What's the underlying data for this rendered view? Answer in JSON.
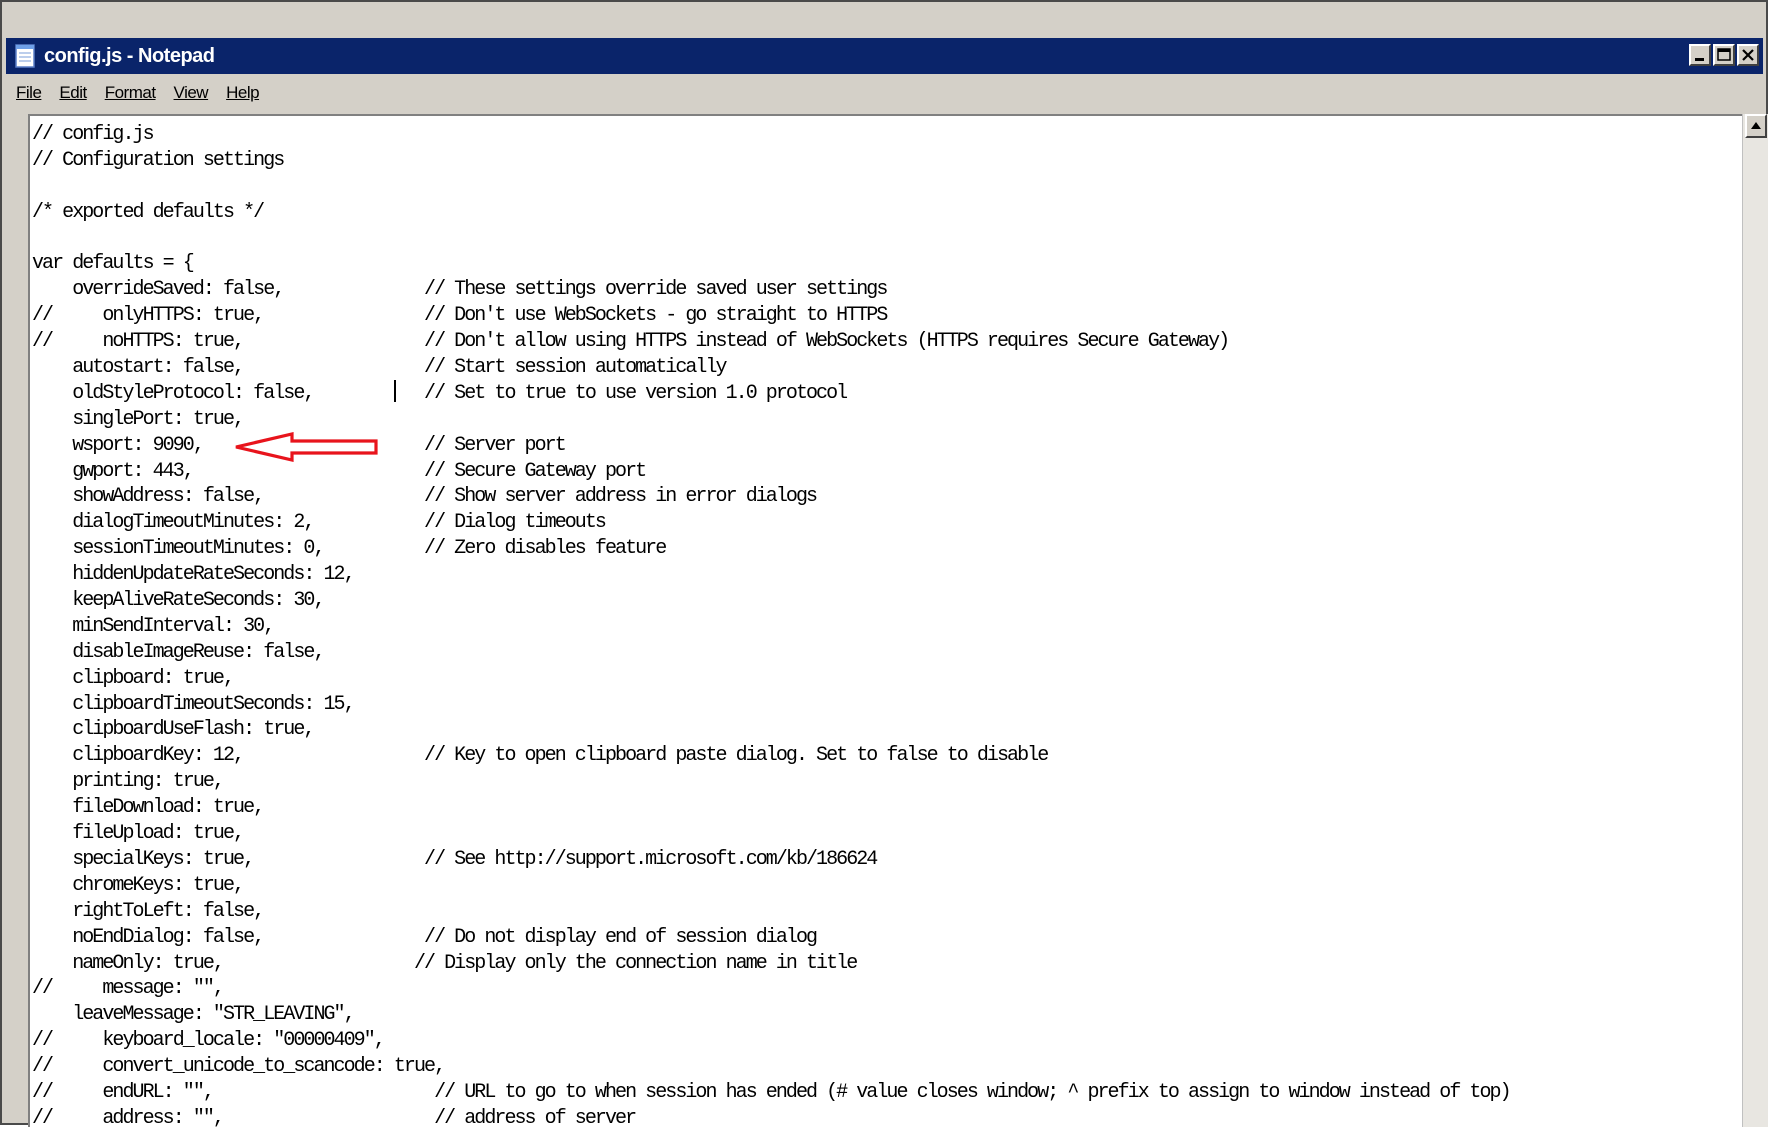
{
  "window": {
    "title": "config.js - Notepad"
  },
  "menu": {
    "items": [
      "File",
      "Edit",
      "Format",
      "View",
      "Help"
    ]
  },
  "editor": {
    "lines": [
      "// config.js",
      "// Configuration settings",
      "",
      "/* exported defaults */",
      "",
      "var defaults = {",
      "    overrideSaved: false,              // These settings override saved user settings",
      "//     onlyHTTPS: true,                // Don't use WebSockets - go straight to HTTPS",
      "//     noHTTPS: true,                  // Don't allow using HTTPS instead of WebSockets (HTTPS requires Secure Gateway)",
      "    autostart: false,                  // Start session automatically",
      "    oldStyleProtocol: false,           // Set to true to use version 1.0 protocol",
      "    singlePort: true,",
      "    wsport: 9090,                      // Server port",
      "    gwport: 443,                       // Secure Gateway port",
      "    showAddress: false,                // Show server address in error dialogs",
      "    dialogTimeoutMinutes: 2,           // Dialog timeouts",
      "    sessionTimeoutMinutes: 0,          // Zero disables feature",
      "    hiddenUpdateRateSeconds: 12,",
      "    keepAliveRateSeconds: 30,",
      "    minSendInterval: 30,",
      "    disableImageReuse: false,",
      "    clipboard: true,",
      "    clipboardTimeoutSeconds: 15,",
      "    clipboardUseFlash: true,",
      "    clipboardKey: 12,                  // Key to open clipboard paste dialog. Set to false to disable",
      "    printing: true,",
      "    fileDownload: true,",
      "    fileUpload: true,",
      "    specialKeys: true,                 // See http://support.microsoft.com/kb/186624",
      "    chromeKeys: true,",
      "    rightToLeft: false,",
      "    noEndDialog: false,                // Do not display end of session dialog",
      "    nameOnly: true,                   // Display only the connection name in title",
      "//     message: \"\",",
      "    leaveMessage: \"STR_LEAVING\",",
      "//     keyboard_locale: \"00000409\",",
      "//     convert_unicode_to_scancode: true,",
      "//     endURL: \"\",                      // URL to go to when session has ended (# value closes window; ^ prefix to assign to window instead of top)",
      "//     address: \"\",                     // address of server"
    ]
  },
  "annotation": {
    "arrow_color": "#e8141c",
    "points_to": "wsport: 9090,"
  },
  "colors": {
    "titlebar": "#0a246a",
    "chrome": "#d4d0c8",
    "editor_bg": "#ffffff"
  }
}
